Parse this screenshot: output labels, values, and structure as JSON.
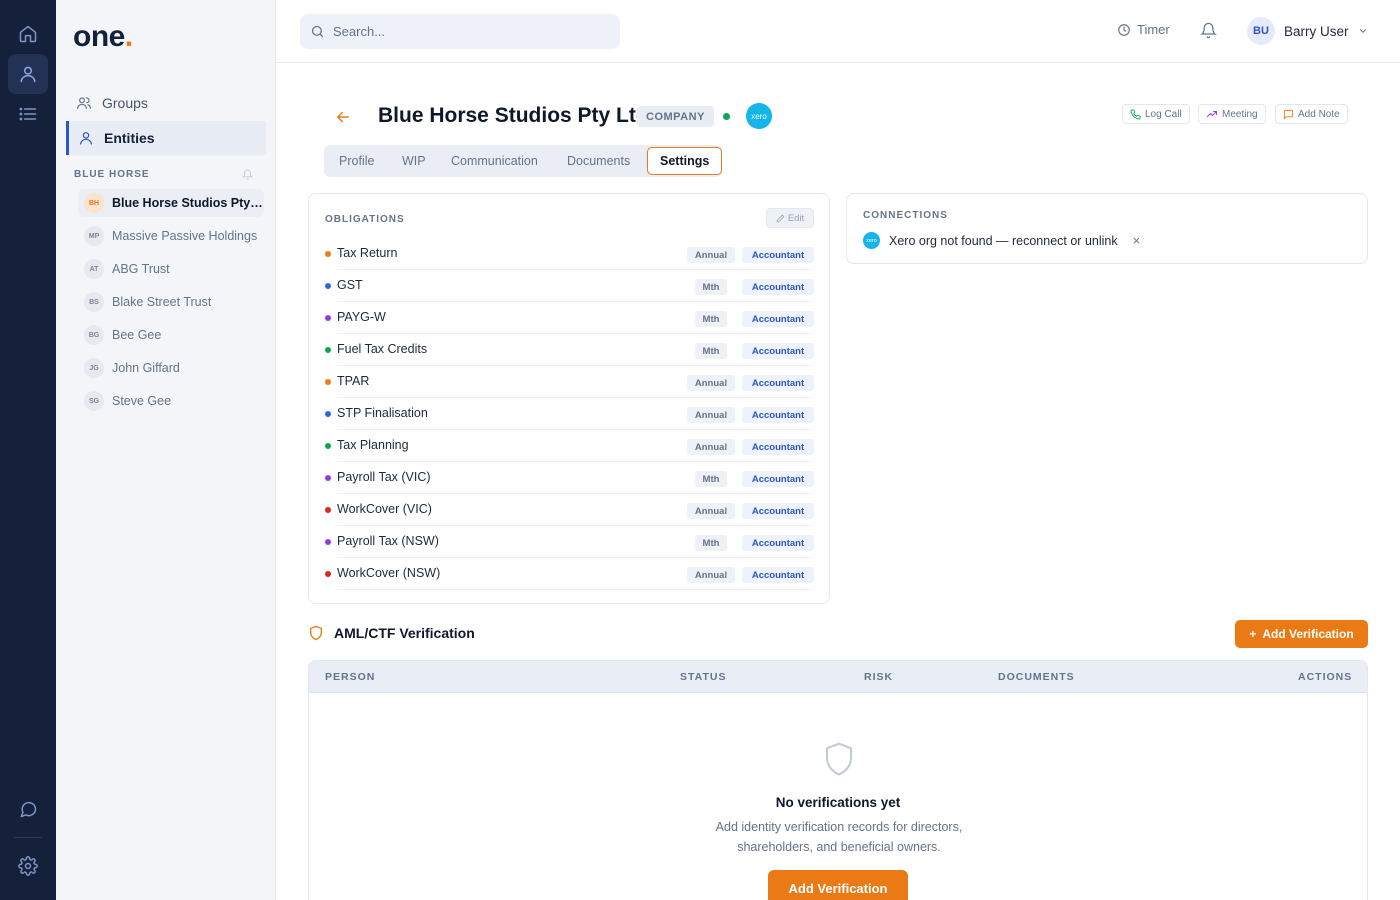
{
  "app": {
    "logo_text": "one",
    "logo_dot": ".",
    "accent_color": "#ea7a16",
    "nav_color": "#15203b"
  },
  "rail": {
    "icons": [
      "home-icon",
      "user-icon",
      "list-icon",
      "chat-icon",
      "settings-icon"
    ],
    "active": "user-icon"
  },
  "sidebar": {
    "nav": [
      {
        "label": "Groups",
        "icon": "users-icon",
        "active": false
      },
      {
        "label": "Entities",
        "icon": "user-icon",
        "active": true
      }
    ],
    "section_label": "BLUE HORSE",
    "entities": [
      {
        "initials": "BH",
        "name": "Blue Horse Studios Pty Ltd",
        "active": true
      },
      {
        "initials": "MP",
        "name": "Massive Passive Holdings",
        "active": false
      },
      {
        "initials": "AT",
        "name": "ABG Trust",
        "active": false
      },
      {
        "initials": "BS",
        "name": "Blake Street Trust",
        "active": false
      },
      {
        "initials": "BG",
        "name": "Bee Gee",
        "active": false
      },
      {
        "initials": "JG",
        "name": "John Giffard",
        "active": false
      },
      {
        "initials": "SG",
        "name": "Steve Gee",
        "active": false
      }
    ]
  },
  "topbar": {
    "search_placeholder": "Search...",
    "timer_label": "Timer",
    "user_initials": "BU",
    "user_name": "Barry User"
  },
  "header": {
    "title": "Blue Horse Studios Pty Ltd",
    "type_badge": "COMPANY",
    "xero_label": "xero",
    "status_color": "#10a35a",
    "actions": {
      "log_call": "Log Call",
      "meeting": "Meeting",
      "add_note": "Add Note"
    }
  },
  "tabs": [
    {
      "label": "Profile",
      "active": false
    },
    {
      "label": "WIP",
      "active": false
    },
    {
      "label": "Communication",
      "active": false
    },
    {
      "label": "Documents",
      "active": false
    },
    {
      "label": "Settings",
      "active": true
    }
  ],
  "obligations": {
    "title": "OBLIGATIONS",
    "edit_label": "Edit",
    "rows": [
      {
        "name": "Tax Return",
        "freq": "Annual",
        "role": "Accountant",
        "color": "#f07c12"
      },
      {
        "name": "GST",
        "freq": "Mth",
        "role": "Accountant",
        "color": "#2f64e9"
      },
      {
        "name": "PAYG-W",
        "freq": "Mth",
        "role": "Accountant",
        "color": "#8b3ee8"
      },
      {
        "name": "Fuel Tax Credits",
        "freq": "Mth",
        "role": "Accountant",
        "color": "#10a35a"
      },
      {
        "name": "TPAR",
        "freq": "Annual",
        "role": "Accountant",
        "color": "#f07c12"
      },
      {
        "name": "STP Finalisation",
        "freq": "Annual",
        "role": "Accountant",
        "color": "#2f64e9"
      },
      {
        "name": "Tax Planning",
        "freq": "Annual",
        "role": "Accountant",
        "color": "#10a35a"
      },
      {
        "name": "Payroll Tax (VIC)",
        "freq": "Mth",
        "role": "Accountant",
        "color": "#8b3ee8"
      },
      {
        "name": "WorkCover (VIC)",
        "freq": "Annual",
        "role": "Accountant",
        "color": "#dc2626"
      },
      {
        "name": "Payroll Tax (NSW)",
        "freq": "Mth",
        "role": "Accountant",
        "color": "#8b3ee8"
      },
      {
        "name": "WorkCover (NSW)",
        "freq": "Annual",
        "role": "Accountant",
        "color": "#dc2626"
      }
    ]
  },
  "connections": {
    "title": "CONNECTIONS",
    "xero_label": "xero",
    "message": "Xero org not found — reconnect or unlink",
    "close_symbol": "×"
  },
  "aml": {
    "title": "AML/CTF Verification",
    "add_button": "Add Verification",
    "add_symbol": "+",
    "columns": [
      "PERSON",
      "STATUS",
      "RISK",
      "DOCUMENTS",
      "ACTIONS"
    ],
    "empty_title": "No verifications yet",
    "empty_desc": "Add identity verification records for directors, shareholders, and beneficial owners.",
    "empty_button": "Add Verification"
  }
}
